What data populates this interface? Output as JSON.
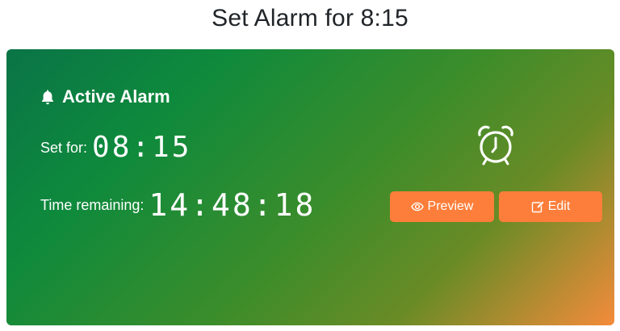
{
  "page": {
    "title": "Set Alarm for 8:15"
  },
  "card": {
    "heading": "Active Alarm",
    "heading_icon": "bell-icon",
    "set_for_label": "Set for:",
    "set_for_value": "08:15",
    "remaining_label": "Time remaining:",
    "remaining_value": "14:48:18",
    "status_icon": "alarm-clock-icon"
  },
  "actions": {
    "preview_label": "Preview",
    "preview_icon": "eye-icon",
    "edit_label": "Edit",
    "edit_icon": "edit-icon"
  },
  "colors": {
    "gradient_start": "#0a7447",
    "gradient_mid": "#3d8d2a",
    "gradient_end": "#f48b3b",
    "button": "#fd7e3a",
    "title_text": "#212529"
  }
}
